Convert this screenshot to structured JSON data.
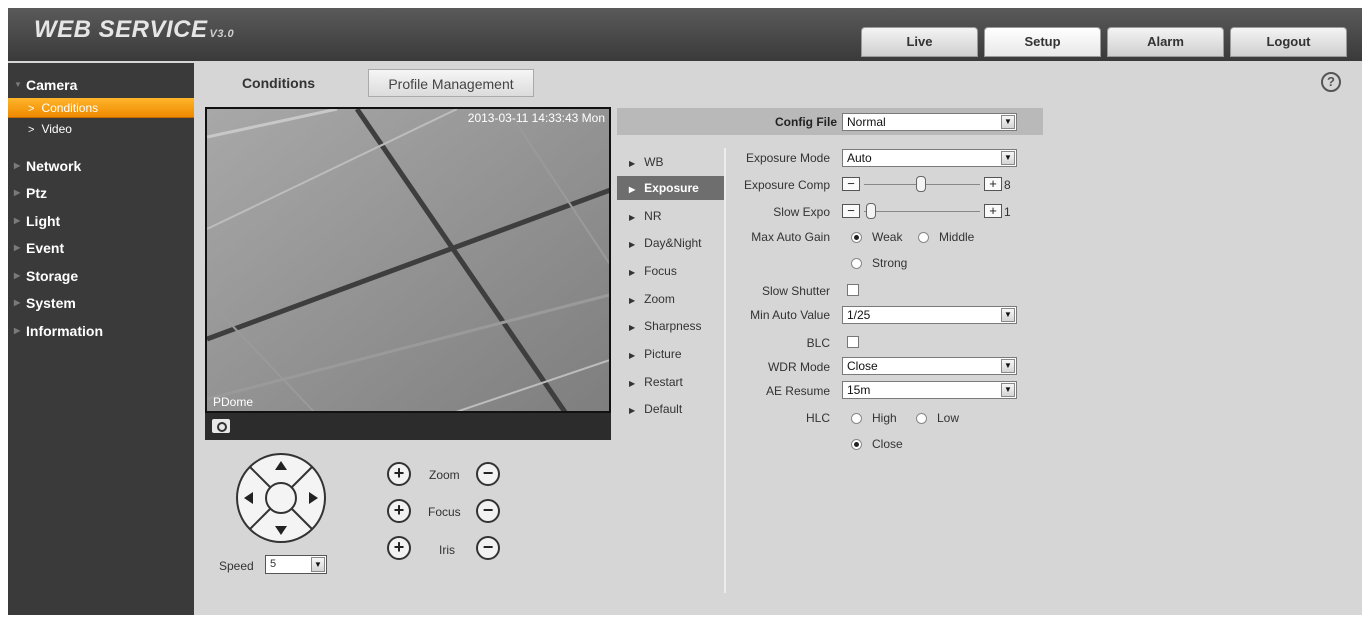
{
  "header": {
    "logo": "WEB SERVICE",
    "version": "V3.0",
    "tabs": [
      {
        "label": "Live"
      },
      {
        "label": "Setup"
      },
      {
        "label": "Alarm"
      },
      {
        "label": "Logout"
      }
    ]
  },
  "sidebar": {
    "camera": "Camera",
    "camera_items": [
      {
        "label": "Conditions"
      },
      {
        "label": "Video"
      }
    ],
    "items": [
      {
        "label": "Network"
      },
      {
        "label": "Ptz"
      },
      {
        "label": "Light"
      },
      {
        "label": "Event"
      },
      {
        "label": "Storage"
      },
      {
        "label": "System"
      },
      {
        "label": "Information"
      }
    ]
  },
  "tabs": {
    "conditions": "Conditions",
    "profile": "Profile Management"
  },
  "help_icon": "?",
  "video": {
    "timestamp": "2013-03-11 14:33:43 Mon",
    "label": "PDome"
  },
  "ptz": {
    "zoom": "Zoom",
    "focus": "Focus",
    "iris": "Iris",
    "plus": "+",
    "minus": "−",
    "speed_label": "Speed",
    "speed_value": "5"
  },
  "config": {
    "config_file_label": "Config File",
    "config_file_value": "Normal"
  },
  "subnav": [
    {
      "label": "WB"
    },
    {
      "label": "Exposure"
    },
    {
      "label": "NR"
    },
    {
      "label": "Day&Night"
    },
    {
      "label": "Focus"
    },
    {
      "label": "Zoom"
    },
    {
      "label": "Sharpness"
    },
    {
      "label": "Picture"
    },
    {
      "label": "Restart"
    },
    {
      "label": "Default"
    }
  ],
  "exposure": {
    "mode_label": "Exposure Mode",
    "mode_value": "Auto",
    "comp_label": "Exposure Comp",
    "comp_value": "8",
    "slow_expo_label": "Slow Expo",
    "slow_expo_value": "1",
    "max_gain_label": "Max Auto Gain",
    "gain_weak": "Weak",
    "gain_middle": "Middle",
    "gain_strong": "Strong",
    "slow_shutter_label": "Slow Shutter",
    "min_auto_label": "Min Auto Value",
    "min_auto_value": "1/25",
    "blc_label": "BLC",
    "wdr_label": "WDR Mode",
    "wdr_value": "Close",
    "ae_resume_label": "AE Resume",
    "ae_resume_value": "15m",
    "hlc_label": "HLC",
    "hlc_high": "High",
    "hlc_low": "Low",
    "hlc_close": "Close"
  },
  "colors": {
    "accent_orange": "#f59a10",
    "header_dark": "#3a3a3a",
    "panel_gray": "#d6d6d6"
  }
}
